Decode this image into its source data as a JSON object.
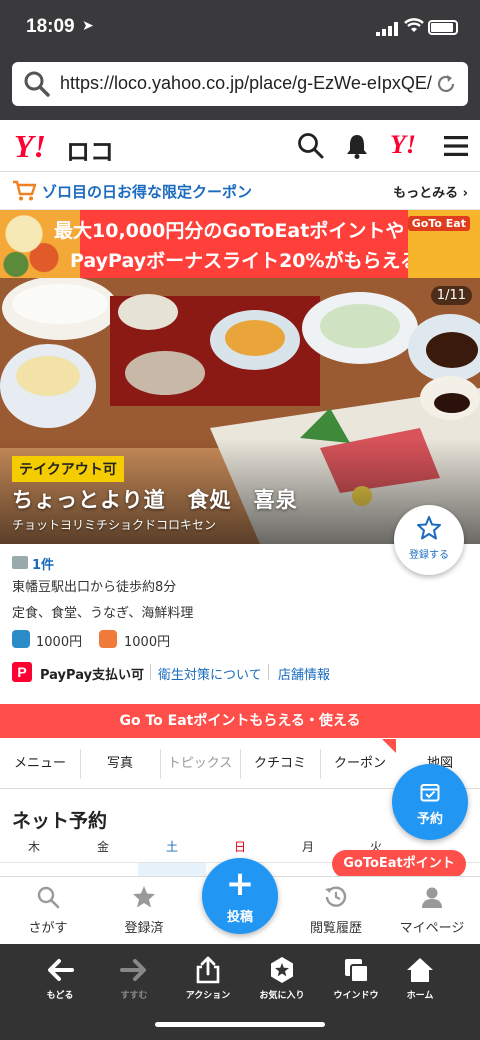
{
  "status_bar": {
    "time": "18:09",
    "location_icon": "location-arrow-icon",
    "signal_icon": "signal-icon",
    "wifi_icon": "wifi-icon",
    "battery_icon": "battery-icon"
  },
  "url_bar": {
    "url": "https://loco.yahoo.co.jp/place/g-EzWe-eIpxQE/",
    "search_icon": "search-icon",
    "reload_icon": "reload-icon"
  },
  "header": {
    "logo_y": "Y!",
    "logo_text": "ロコ",
    "yj_mark": "Y!",
    "icons": [
      "search-icon",
      "bell-icon",
      "yahoo-japan-icon",
      "menu-icon"
    ]
  },
  "coupon_strip": {
    "title": "ゾロ目の日お得な限定クーポン",
    "more": "もっとみる ›"
  },
  "banner": {
    "line1": "最大10,000円分のGoToEatポイントや",
    "line2": "PayPayボーナスライト20%がもらえる",
    "badge": "GoTo Eat"
  },
  "hero": {
    "counter": "1/11",
    "takeout": "テイクアウト可",
    "name": "ちょっとより道　食処　喜泉",
    "kana": "チョットヨリミチショクドコロキセン"
  },
  "favorite": {
    "label": "登録する"
  },
  "info": {
    "review_count": "1件",
    "access": "東幡豆駅出口から徒歩約8分",
    "genres": "定食、食堂、うなぎ、海鮮料理",
    "price_dinner": "1000円",
    "price_lunch": "1000円",
    "pay_mark": "P",
    "paypay": "PayPay支払い可",
    "hygiene_link": "衛生対策について",
    "shop_info_link": "店舗情報"
  },
  "gte_bar": {
    "text": "Go To Eatポイントもらえる・使える"
  },
  "tabs": [
    {
      "label": "メニュー"
    },
    {
      "label": "写真"
    },
    {
      "label": "トピックス"
    },
    {
      "label": "クチコミ"
    },
    {
      "label": "クーポン"
    },
    {
      "label": "地図"
    }
  ],
  "reserve_button": {
    "label": "予約"
  },
  "net_booking": {
    "title": "ネット予約",
    "days": [
      "木",
      "金",
      "土",
      "日",
      "月",
      "火"
    ]
  },
  "gte_pill": {
    "label": "GoToEatポイント"
  },
  "bottom_nav": {
    "items": [
      {
        "label": "さがす",
        "icon": "search-icon"
      },
      {
        "label": "登録済",
        "icon": "star-icon"
      },
      {
        "label": "閲覧履歴",
        "icon": "history-icon"
      },
      {
        "label": "マイページ",
        "icon": "user-icon"
      }
    ],
    "post": {
      "symbol": "+",
      "label": "投稿"
    }
  },
  "browser_toolbar": {
    "items": [
      {
        "label": "もどる",
        "icon": "back-arrow-icon"
      },
      {
        "label": "すすむ",
        "icon": "forward-arrow-icon"
      },
      {
        "label": "アクション",
        "icon": "share-icon"
      },
      {
        "label": "お気に入り",
        "icon": "bookmark-star-icon"
      },
      {
        "label": "ウインドウ",
        "icon": "windows-icon"
      },
      {
        "label": "ホーム",
        "icon": "home-icon"
      }
    ]
  },
  "colors": {
    "brand_red": "#ff0033",
    "link_blue": "#1a6bbf",
    "action_blue": "#2196f3",
    "promo_red": "#ff4f4a",
    "takeout_yellow": "#f5cc00"
  }
}
